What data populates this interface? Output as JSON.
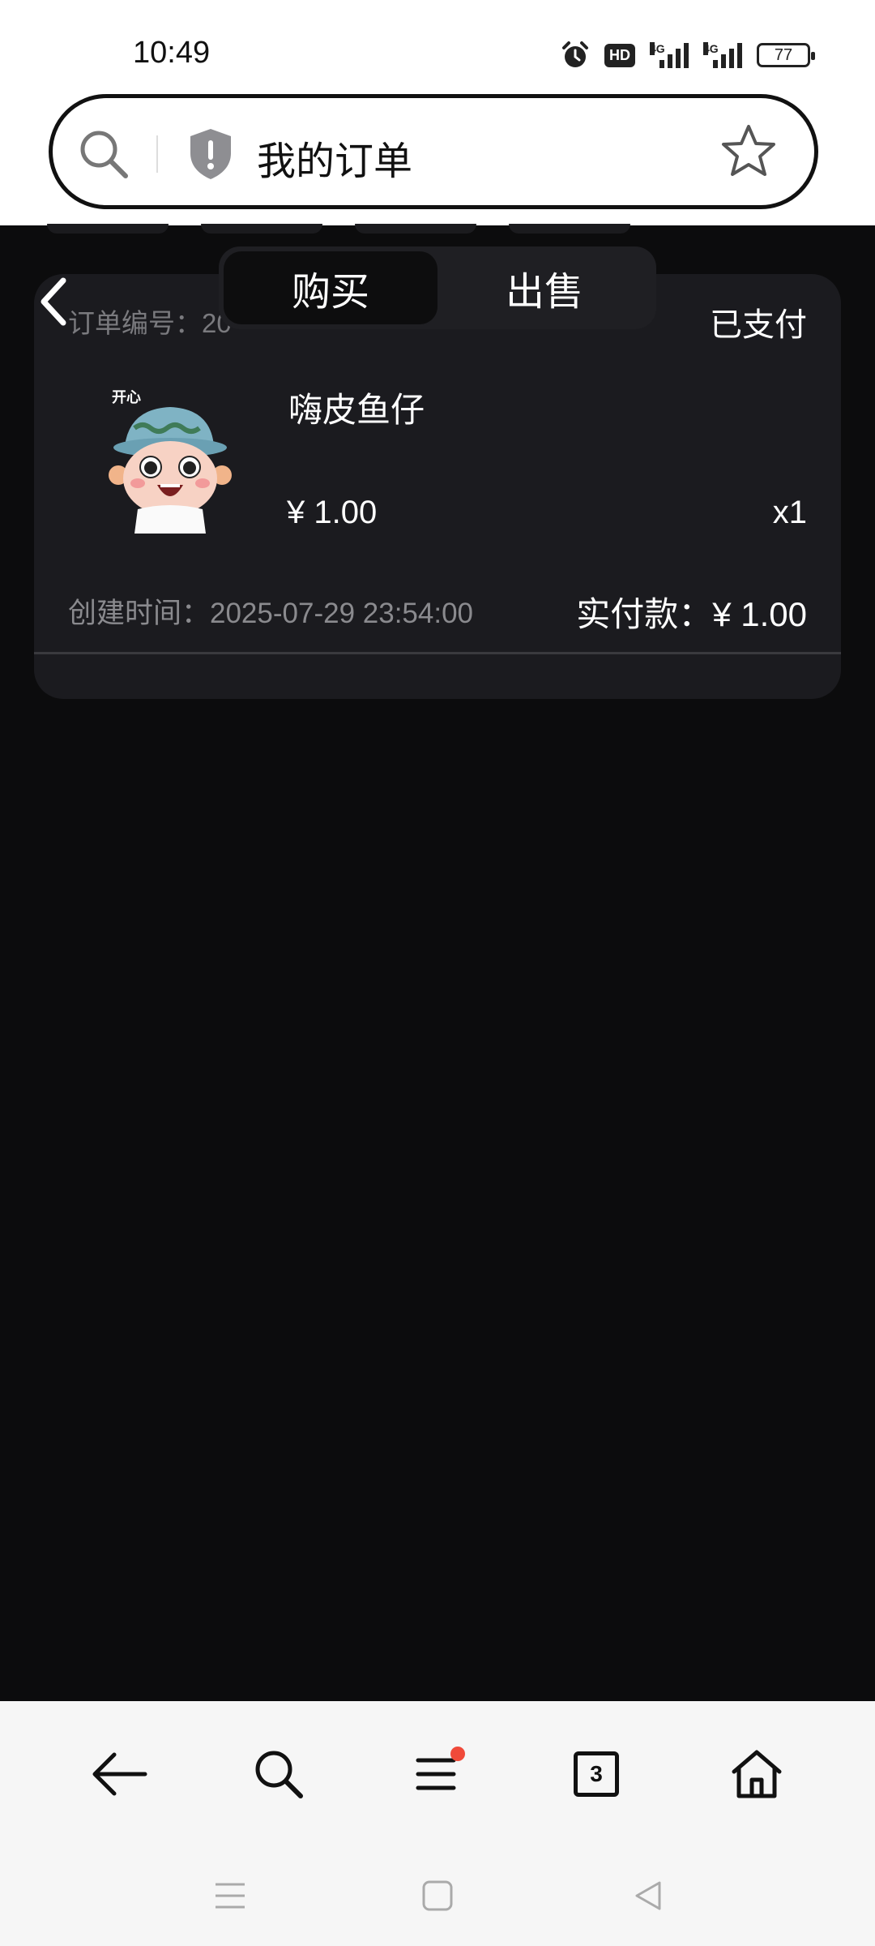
{
  "status_bar": {
    "time": "10:49",
    "hd_label": "HD",
    "signal_label": "4G",
    "battery": "77",
    "icons": [
      "alarm-icon",
      "hd-voice-icon",
      "signal-4g-icon",
      "signal-4g-icon",
      "battery-icon"
    ]
  },
  "address_bar": {
    "title": "我的订单",
    "icons": [
      "search-icon",
      "shield-warning-icon",
      "star-icon"
    ]
  },
  "segmented": {
    "tabs": [
      {
        "label": "购买",
        "active": true
      },
      {
        "label": "出售",
        "active": false
      }
    ]
  },
  "order": {
    "order_no_label": "订单编号：20",
    "status": "已支付",
    "product_name": "嗨皮鱼仔",
    "sticker_text": "开心",
    "price": "¥ 1.00",
    "quantity": "x1",
    "created_time": "创建时间：2025-07-29 23:54:00",
    "paid_amount": "实付款：¥ 1.00"
  },
  "bottom_toolbar": {
    "tab_count": "3",
    "icons": [
      "back-arrow-icon",
      "search-icon",
      "menu-icon",
      "tabs-icon",
      "home-icon"
    ]
  },
  "colors": {
    "background": "#0c0c0d",
    "card": "#1b1b1f",
    "notification_dot": "#f04a3a"
  }
}
